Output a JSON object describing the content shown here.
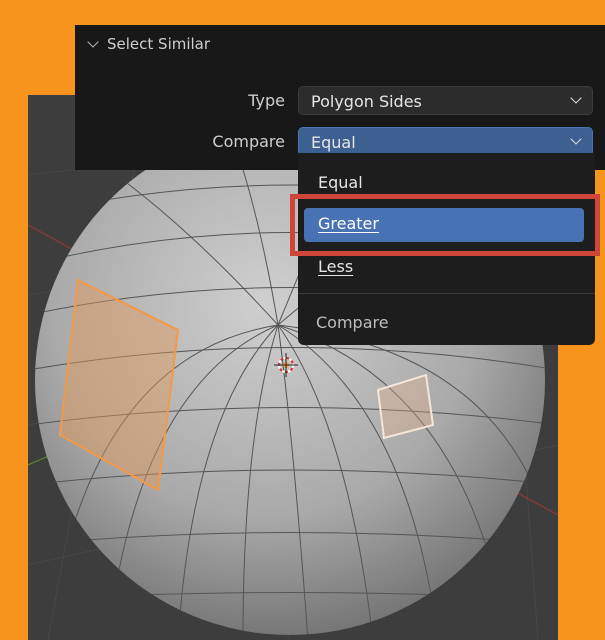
{
  "panel": {
    "title": "Select Similar",
    "type_label": "Type",
    "type_value": "Polygon Sides",
    "compare_label": "Compare",
    "compare_value": "Equal"
  },
  "dropdown": {
    "options": [
      "Equal",
      "Greater",
      "Less"
    ],
    "selected_hover": "Greater",
    "footer": "Compare"
  },
  "colors": {
    "background": "#f7941d",
    "panel": "#181818",
    "highlight": "#4772b3",
    "callout": "#d0453a",
    "selected_face": "#e59a5a"
  },
  "icons": [
    "chevron-down-icon",
    "3d-cursor-icon"
  ]
}
